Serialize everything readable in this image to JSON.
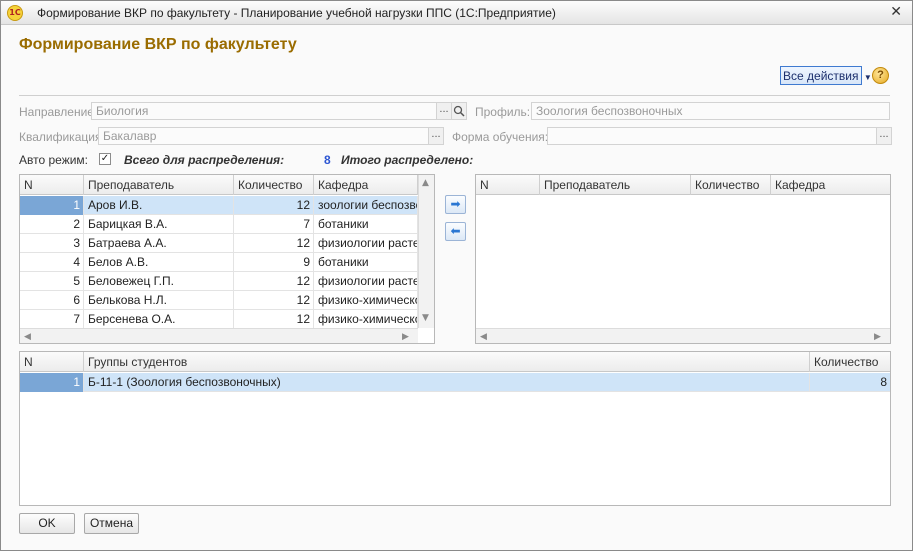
{
  "window": {
    "title": "Формирование ВКР по факультету - Планирование учебной нагрузки ППС  (1С:Предприятие)",
    "logo_text": "1С"
  },
  "form": {
    "title": "Формирование ВКР по факультету",
    "all_actions_label": "Все действия",
    "help_label": "?"
  },
  "fields": {
    "direction_label": "Направление:",
    "direction_value": "Биология",
    "profile_label": "Профиль:",
    "profile_value": "Зоология беспозвоночных",
    "qualification_label": "Квалификация:",
    "qualification_value": "Бакалавр",
    "study_form_label": "Форма обучения:",
    "study_form_value": "",
    "select_button": "...",
    "auto_mode_label": "Авто режим:",
    "auto_mode_checked": "✓",
    "total_label": "Всего для распределения:",
    "total_value": "8",
    "distributed_label": "Итого распределено:"
  },
  "teachers_grid": {
    "headers": [
      "N",
      "Преподаватель",
      "Количество",
      "Кафедра"
    ],
    "rows": [
      {
        "n": "1",
        "name": "Аров И.В.",
        "count": "12",
        "dept": "зоологии беспозвоночных"
      },
      {
        "n": "2",
        "name": "Барицкая В.А.",
        "count": "7",
        "dept": "ботаники"
      },
      {
        "n": "3",
        "name": "Батраева А.А.",
        "count": "12",
        "dept": "физиологии растений"
      },
      {
        "n": "4",
        "name": "Белов А.В.",
        "count": "9",
        "dept": "ботаники"
      },
      {
        "n": "5",
        "name": "Беловежец Г.П.",
        "count": "12",
        "dept": "физиологии растений"
      },
      {
        "n": "6",
        "name": "Белькова Н.Л.",
        "count": "12",
        "dept": "физико-химической биологии"
      },
      {
        "n": "7",
        "name": "Берсенева О.А.",
        "count": "12",
        "dept": "физико-химической биологии"
      }
    ]
  },
  "distributed_grid": {
    "headers": [
      "N",
      "Преподаватель",
      "Количество",
      "Кафедра"
    ],
    "rows": []
  },
  "groups_grid": {
    "headers": [
      "N",
      "Группы студентов",
      "Количество"
    ],
    "rows": [
      {
        "n": "1",
        "group": "Б-11-1 (Зоология беспозвоночных)",
        "count": "8"
      }
    ]
  },
  "transfer": {
    "right_icon": "arrow-right-icon",
    "left_icon": "arrow-left-icon"
  },
  "buttons": {
    "ok": "OK",
    "cancel": "Отмена"
  },
  "colors": {
    "title": "#9a6c00",
    "selected_row": "#cfe4f8",
    "selected_cell": "#7aa6d6",
    "total_number": "#2d56d2"
  }
}
